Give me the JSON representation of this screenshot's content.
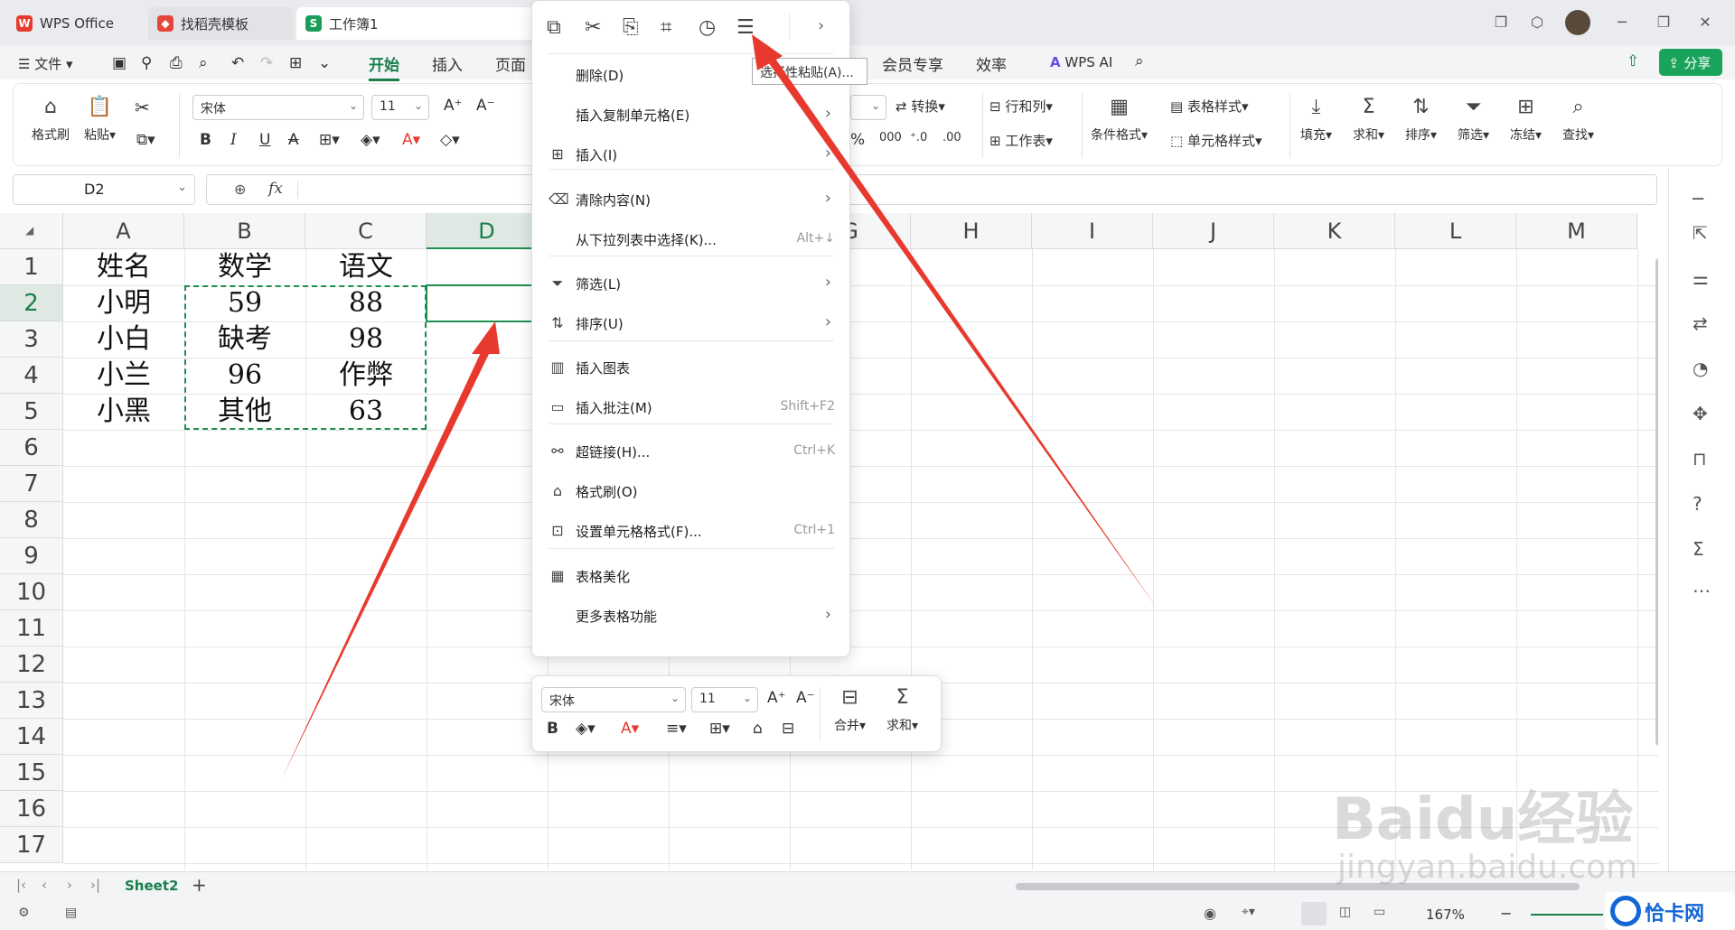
{
  "tabs": [
    {
      "label": "WPS Office",
      "icon": "wps-logo"
    },
    {
      "label": "找稻壳模板",
      "icon": "docer-logo"
    },
    {
      "label": "工作簿1",
      "icon": "sheet-logo"
    }
  ],
  "menu": {
    "file": "文件",
    "tabs": [
      "开始",
      "插入",
      "页面"
    ],
    "right_tabs": [
      "会员专享",
      "效率"
    ],
    "wps_ai": "WPS AI",
    "share": "分享"
  },
  "ribbon": {
    "format_painter": "格式刷",
    "paste": "粘贴",
    "font_name": "宋体",
    "font_size": "11",
    "convert": "转换",
    "rows_cols": "行和列",
    "table_style": "表格样式",
    "worksheet": "工作表",
    "cond_format": "条件格式",
    "cell_style": "单元格样式",
    "fill": "填充",
    "sum": "求和",
    "sort": "排序",
    "filter": "筛选",
    "freeze": "冻结",
    "find": "查找"
  },
  "formula": {
    "name_box": "D2",
    "fx": "fx"
  },
  "columns": [
    "A",
    "B",
    "C",
    "D",
    "",
    "",
    "G",
    "H",
    "I",
    "J",
    "K",
    "L",
    "M"
  ],
  "rows": [
    "1",
    "2",
    "3",
    "4",
    "5",
    "6",
    "7",
    "8",
    "9",
    "10",
    "11",
    "12",
    "13",
    "14",
    "15",
    "16",
    "17"
  ],
  "cells": [
    [
      "姓名",
      "数学",
      "语文"
    ],
    [
      "小明",
      "59",
      "88"
    ],
    [
      "小白",
      "缺考",
      "98"
    ],
    [
      "小兰",
      "96",
      "作弊"
    ],
    [
      "小黑",
      "其他",
      "63"
    ]
  ],
  "context_menu": {
    "tooltip": "选择性粘贴(A)...",
    "items": [
      {
        "label": "删除(D)",
        "shortcut": ""
      },
      {
        "label": "插入复制单元格(E)",
        "shortcut": ""
      },
      {
        "label": "插入(I)",
        "shortcut": ""
      },
      {
        "label": "清除内容(N)",
        "shortcut": ""
      },
      {
        "label": "从下拉列表中选择(K)...",
        "shortcut": "Alt+↓"
      },
      {
        "label": "筛选(L)",
        "shortcut": ""
      },
      {
        "label": "排序(U)",
        "shortcut": ""
      },
      {
        "label": "插入图表",
        "shortcut": ""
      },
      {
        "label": "插入批注(M)",
        "shortcut": "Shift+F2"
      },
      {
        "label": "超链接(H)...",
        "shortcut": "Ctrl+K"
      },
      {
        "label": "格式刷(O)",
        "shortcut": ""
      },
      {
        "label": "设置单元格格式(F)...",
        "shortcut": "Ctrl+1"
      },
      {
        "label": "表格美化",
        "shortcut": ""
      },
      {
        "label": "更多表格功能",
        "shortcut": ""
      }
    ]
  },
  "mini_toolbar": {
    "font_name": "宋体",
    "font_size": "11",
    "merge": "合并",
    "sum": "求和"
  },
  "sheet": {
    "active": "Sheet2"
  },
  "status": {
    "zoom": "167%"
  },
  "watermark": {
    "brand": "Baidu经验",
    "url": "jingyan.baidu.com",
    "site": "恰卡网"
  },
  "colors": {
    "accent": "#1a7f4b",
    "red": "#e8392e",
    "selection": "#1e8e4e"
  }
}
